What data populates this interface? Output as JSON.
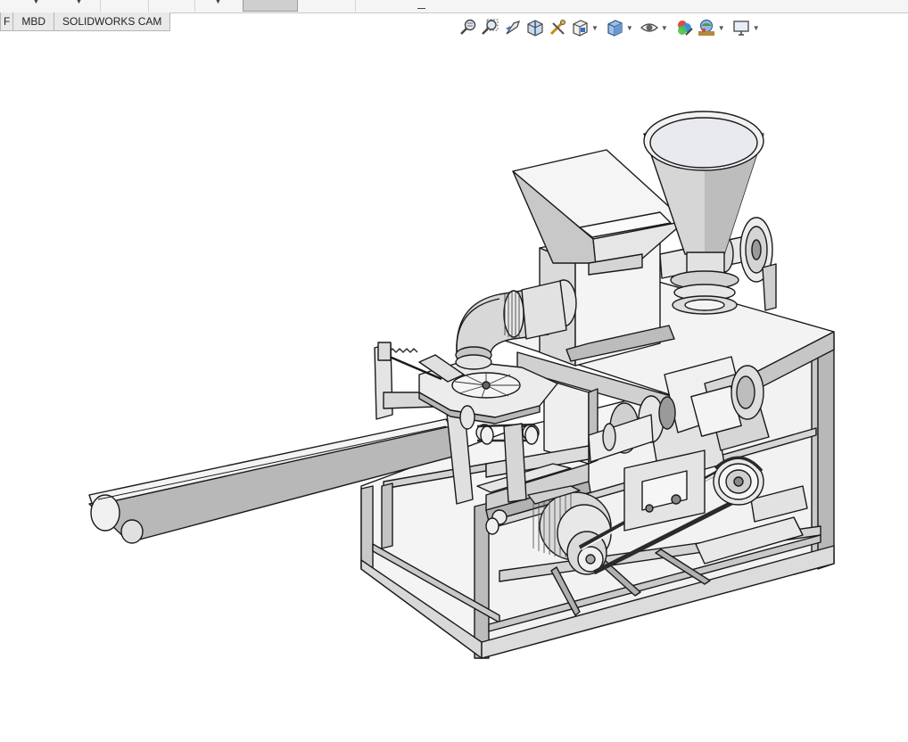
{
  "command_manager": {
    "tabs": [
      {
        "label": "F"
      },
      {
        "label": "MBD"
      },
      {
        "label": "SOLIDWORKS CAM"
      }
    ]
  },
  "heads_up_toolbar": {
    "buttons": [
      {
        "icon": "zoom-to-fit-icon",
        "has_dropdown": false
      },
      {
        "icon": "zoom-to-area-icon",
        "has_dropdown": false
      },
      {
        "icon": "previous-view-icon",
        "has_dropdown": false
      },
      {
        "icon": "section-view-icon",
        "has_dropdown": false
      },
      {
        "icon": "dynamic-annotation-views-icon",
        "has_dropdown": false
      },
      {
        "icon": "view-orientation-icon",
        "has_dropdown": true
      },
      {
        "icon": "display-style-icon",
        "has_dropdown": true
      },
      {
        "icon": "hide-show-items-icon",
        "has_dropdown": true
      },
      {
        "icon": "edit-appearance-icon",
        "has_dropdown": false
      },
      {
        "icon": "apply-scene-icon",
        "has_dropdown": true
      },
      {
        "icon": "view-settings-icon",
        "has_dropdown": true
      }
    ]
  },
  "model": {
    "name": "",
    "colors": {
      "body": "#ececec",
      "shade": "#b9b9b9",
      "dark": "#8f8f8f",
      "edge": "#1a1a1a",
      "belt": "#2a2a2a"
    }
  }
}
